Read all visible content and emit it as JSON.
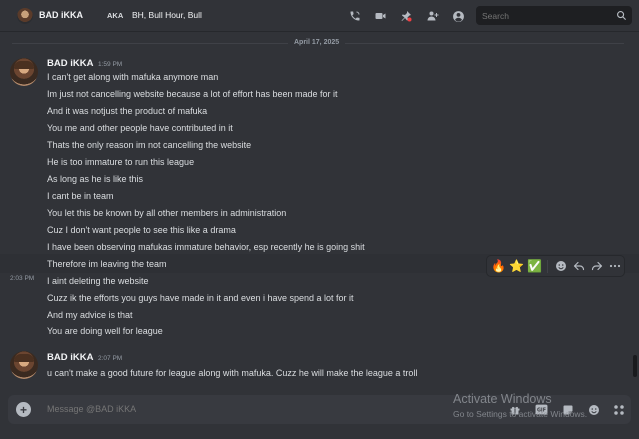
{
  "header": {
    "user_name": "BAD iKKA",
    "aka_label": "AKA",
    "aka_names": "BH, Bull Hour, Bull",
    "icons": [
      "voice-call-icon",
      "video-call-icon",
      "pinned-messages-icon",
      "add-friends-icon",
      "user-profile-icon"
    ]
  },
  "search": {
    "placeholder": "Search"
  },
  "date_divider": "April 17, 2025",
  "messages": [
    {
      "author": "BAD iKKA",
      "time": "1:59 PM",
      "lines": [
        "I can't get along with mafuka anymore man",
        "Im just not cancelling website because a lot of effort has been made for it",
        "And it was notjust the product of mafuka",
        "You me and other people have contributed in it",
        "Thats the only reason im not cancelling the website",
        "He is too immature to run this league",
        "As long as he is like this",
        "I cant be in team",
        "You let this be known by all other members in administration",
        "Cuz I don't want people to see this like a drama",
        "I have been observing mafukas immature behavior, esp recently he is going shit",
        "Therefore im leaving the team",
        "I aint deleting the website",
        "Cuzz ik the efforts you guys have made in it and even i have spend a lot for it",
        "And my advice is that",
        "You are doing well for league"
      ],
      "hover_time": "2:03 PM"
    },
    {
      "author": "BAD iKKA",
      "time": "2:07 PM",
      "lines": [
        "u can't make a good future for league along with mafuka. Cuzz he will make the league a troll"
      ]
    }
  ],
  "actions": {
    "reactions": [
      "🔥",
      "⭐",
      "✅"
    ],
    "buttons": [
      "add-reaction",
      "reply",
      "forward",
      "more"
    ]
  },
  "composer": {
    "placeholder": "Message @BAD iKKA"
  },
  "watermark": {
    "line1": "Activate Windows",
    "line2": "Go to Settings to activate Windows."
  }
}
